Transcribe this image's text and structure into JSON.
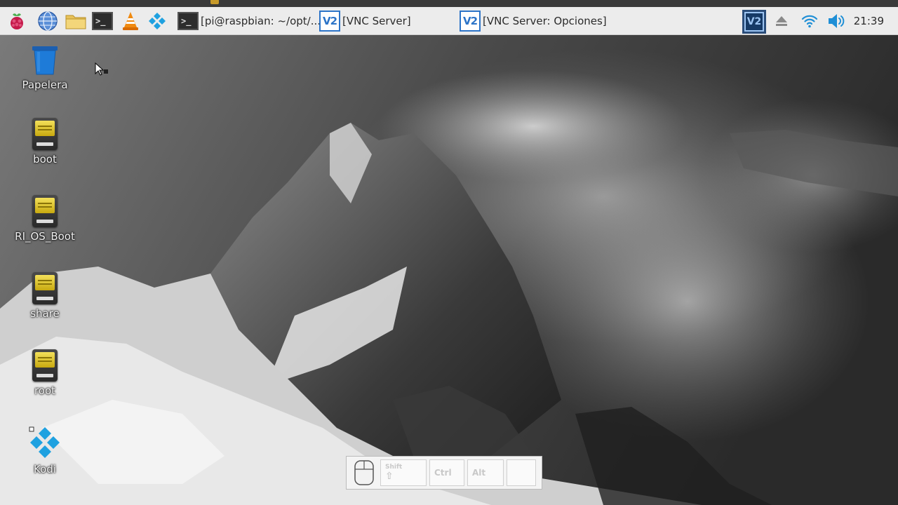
{
  "taskbar": {
    "launchers": [
      {
        "name": "raspberry-menu-icon"
      },
      {
        "name": "web-browser-icon"
      },
      {
        "name": "file-manager-icon"
      },
      {
        "name": "terminal-icon"
      },
      {
        "name": "vlc-icon"
      },
      {
        "name": "kodi-icon"
      }
    ],
    "tasks": [
      {
        "label": "[pi@raspbian: ~/opt/...",
        "icon": "terminal-icon"
      },
      {
        "label": "[VNC Server]",
        "icon": "vnc-icon"
      },
      {
        "label": "[VNC Server: Opciones]",
        "icon": "vnc-icon"
      }
    ],
    "tray": {
      "vnc_glyph": "V2",
      "clock": "21:39",
      "icons": [
        "vnc-tray-icon",
        "eject-icon",
        "wifi-icon",
        "volume-icon"
      ]
    }
  },
  "desktop": {
    "items": [
      {
        "label": "Papelera",
        "icon": "trash-icon"
      },
      {
        "label": "boot",
        "icon": "drive-icon"
      },
      {
        "label": "RI_OS_Boot",
        "icon": "drive-icon"
      },
      {
        "label": "share",
        "icon": "drive-icon"
      },
      {
        "label": "root",
        "icon": "drive-icon"
      },
      {
        "label": "Kodi",
        "icon": "kodi-icon"
      }
    ]
  },
  "keyboard_overlay": {
    "keys": [
      "Shift",
      "Ctrl",
      "Alt",
      ""
    ]
  },
  "colors": {
    "taskbar_bg": "#ececec",
    "vnc_blue": "#2c74c8",
    "kodi_blue": "#1fa1e0",
    "raspberry_red": "#c51a4a"
  }
}
